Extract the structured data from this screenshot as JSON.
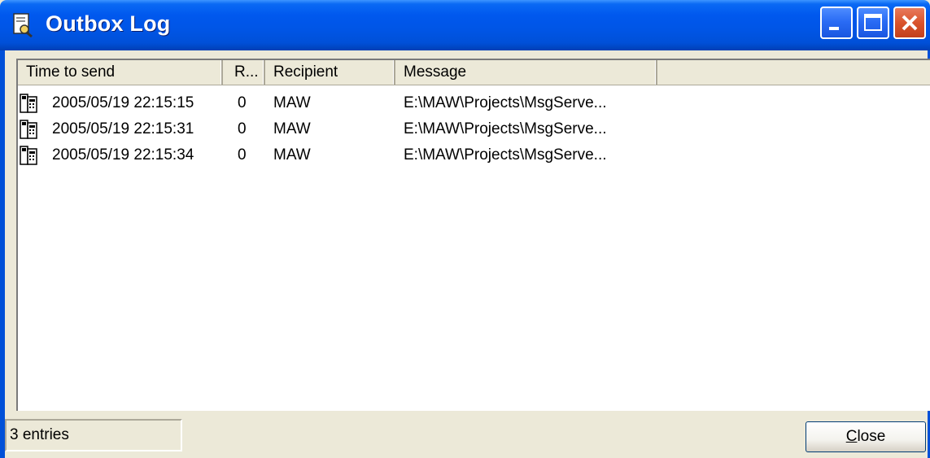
{
  "window": {
    "title": "Outbox Log",
    "controls": {
      "minimize": "minimize-icon",
      "maximize": "maximize-icon",
      "close": "close-icon"
    }
  },
  "columns": [
    {
      "label": "Time to send"
    },
    {
      "label": "R..."
    },
    {
      "label": "Recipient"
    },
    {
      "label": "Message"
    },
    {
      "label": ""
    }
  ],
  "rows": [
    {
      "icon": "fax-document-icon",
      "time": "2005/05/19  22:15:15",
      "retries": "0",
      "recipient": "MAW",
      "message": "E:\\MAW\\Projects\\MsgServe..."
    },
    {
      "icon": "fax-document-icon",
      "time": "2005/05/19  22:15:31",
      "retries": "0",
      "recipient": "MAW",
      "message": "E:\\MAW\\Projects\\MsgServe..."
    },
    {
      "icon": "fax-document-icon",
      "time": "2005/05/19  22:15:34",
      "retries": "0",
      "recipient": "MAW",
      "message": "E:\\MAW\\Projects\\MsgServe..."
    }
  ],
  "status": {
    "entries": "3 entries"
  },
  "buttons": {
    "close_mnemonic": "C",
    "close_rest": "lose"
  },
  "colors": {
    "titlebar": "#0055e5",
    "frame": "#0050d8",
    "face": "#ece9d8"
  }
}
